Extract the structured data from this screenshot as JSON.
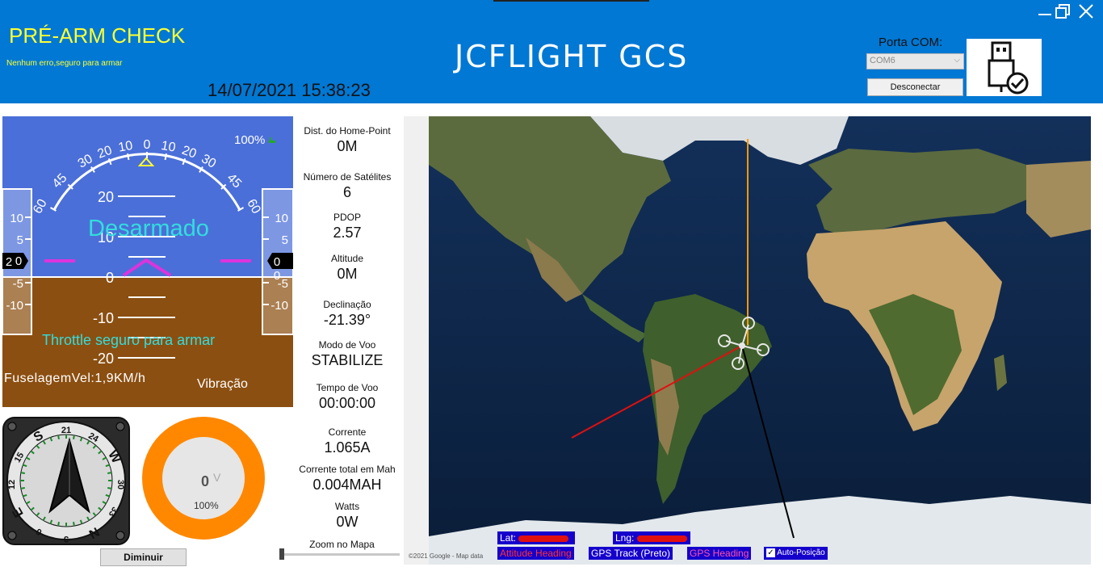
{
  "header": {
    "prearm_title": "PRÉ-ARM CHECK",
    "prearm_message": "Nenhum erro,seguro para armar",
    "datetime": "14/07/2021 15:38:23",
    "app_title": "JCFLIGHT GCS",
    "port_label": "Porta COM:",
    "port_value": "COM6",
    "disconnect_label": "Desconectar",
    "background_color": "#0078d4",
    "accent_color": "#ffff33"
  },
  "horizon": {
    "status": "Desarmado",
    "throttle_message": "Throttle seguro para armar",
    "speed": "FuselagemVel:1,9KM/h",
    "vibration_label": "Vibração",
    "battery_percent": "100%",
    "bank_scale": [
      "60",
      "45",
      "30",
      "20",
      "10",
      "0",
      "10",
      "20",
      "30",
      "45",
      "60"
    ],
    "pitch_ticks": [
      "20",
      "10",
      "0",
      "-10",
      "-20"
    ],
    "left_tape_value": "2",
    "right_tape_value": "0",
    "left_tape_ticks": [
      "10",
      "5",
      "0",
      "-5",
      "-10"
    ],
    "right_tape_ticks": [
      "10",
      "5",
      "0",
      "-5",
      "-10"
    ],
    "sky_color": "#4b6fd8",
    "ground_color": "#8b4f11",
    "text_color": "#33dddd"
  },
  "compass": {
    "heading": "N",
    "labels": [
      "N",
      "3",
      "6",
      "E",
      "12",
      "15",
      "S",
      "21",
      "24",
      "W",
      "30",
      "33"
    ]
  },
  "battery_gauge": {
    "voltage": "0",
    "unit": "V",
    "percent": "100%",
    "ring_color": "#ff8800"
  },
  "telemetry": [
    {
      "label": "Dist. do Home-Point",
      "value": "0M"
    },
    {
      "label": "Número de Satélites",
      "value": "6"
    },
    {
      "label": "PDOP",
      "value": "2.57"
    },
    {
      "label": "Altitude",
      "value": "0M"
    },
    {
      "label": "Declinação",
      "value": "-21.39°"
    },
    {
      "label": "Modo de Voo",
      "value": "STABILIZE"
    },
    {
      "label": "Tempo de Voo",
      "value": "00:00:00"
    },
    {
      "label": "Corrente",
      "value": "1.065A"
    },
    {
      "label": "Corrente total em Mah",
      "value": "0.004MAH"
    },
    {
      "label": "Watts",
      "value": "0W"
    }
  ],
  "controls": {
    "shrink_label": "Diminuir",
    "zoom_label": "Zoom no Mapa",
    "zoom_value": 0
  },
  "map": {
    "lat_label": "Lat:",
    "lng_label": "Lng:",
    "attitude_heading": "Attitude Heading",
    "gps_track": "GPS Track (Preto)",
    "gps_heading": "GPS Heading",
    "auto_position": "Auto-Posição",
    "auto_position_checked": true,
    "copyright": "©2021 Google - Map data",
    "attitude_color": "#e01010",
    "gps_track_color": "#000000",
    "gps_heading_color": "#ff9900",
    "badge_color": "#1500cc"
  }
}
